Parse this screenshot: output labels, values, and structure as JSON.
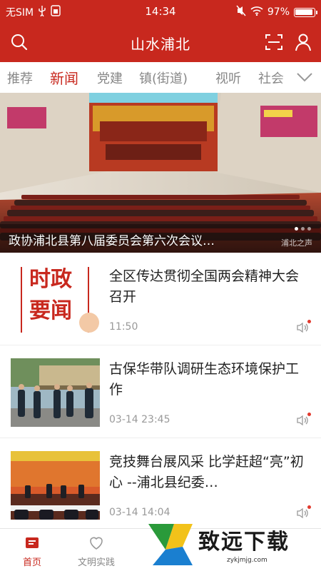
{
  "status_bar": {
    "carrier": "无SIM",
    "time": "14:34",
    "battery_percent": "97%",
    "battery_level": 0.97
  },
  "app": {
    "title": "山水浦北"
  },
  "tabs": [
    {
      "label": "推荐",
      "active": false
    },
    {
      "label": "新闻",
      "active": true
    },
    {
      "label": "党建",
      "active": false
    },
    {
      "label": "镇(街道)",
      "active": false
    },
    {
      "label": "视听",
      "active": false
    },
    {
      "label": "社会",
      "active": false
    }
  ],
  "hero": {
    "caption": "政协浦北县第八届委员会第六次会议…",
    "watermark": "浦北之声"
  },
  "news": [
    {
      "title": "全区传达贯彻全国两会精神大会召开",
      "time": "11:50",
      "thumb_text": [
        "时政",
        "要闻"
      ]
    },
    {
      "title": "古保华带队调研生态环境保护工作",
      "time": "03-14 23:45"
    },
    {
      "title": "竞技舞台展风采 比学赶超“亮”初心 --浦北县纪委…",
      "time": "03-14 14:04"
    }
  ],
  "bottom_nav": [
    {
      "label": "首页",
      "active": true,
      "icon": "home-icon"
    },
    {
      "label": "文明实践",
      "active": false,
      "icon": "civilization-icon"
    }
  ],
  "promo": {
    "text": "致远下载",
    "sub": "zykjmjg.com"
  },
  "colors": {
    "brand": "#c8281e",
    "muted": "#888888"
  }
}
